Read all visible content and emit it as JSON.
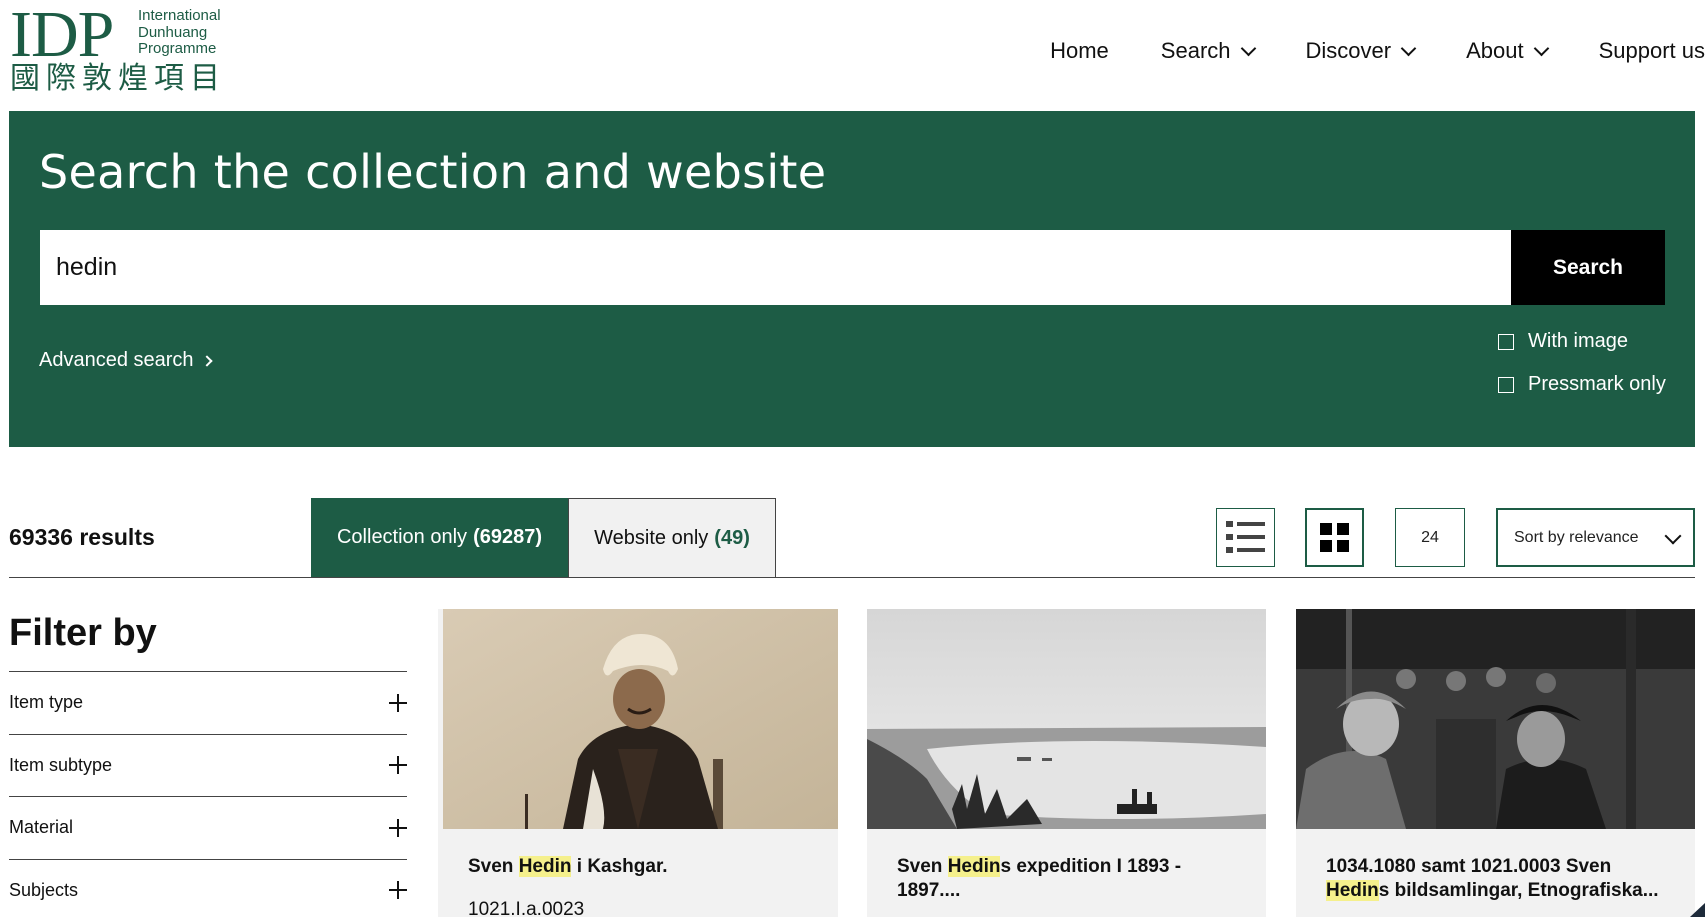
{
  "logo": {
    "text": "IDP",
    "line1": "International",
    "line2": "Dunhuang",
    "line3": "Programme",
    "chinese": "國際敦煌項目"
  },
  "nav": {
    "home": "Home",
    "search": "Search",
    "discover": "Discover",
    "about": "About",
    "support": "Support us"
  },
  "search_panel": {
    "title": "Search the collection and website",
    "query": "hedin",
    "button": "Search",
    "advanced": "Advanced search",
    "with_image": "With image",
    "pressmark_only": "Pressmark only"
  },
  "results": {
    "count": "69336 results",
    "tab_collection": "Collection only",
    "tab_collection_count": "(69287)",
    "tab_website": "Website only",
    "tab_website_count": "(49)",
    "per_page": "24",
    "sort": "Sort by relevance"
  },
  "filters": {
    "title": "Filter by",
    "items": [
      "Item type",
      "Item subtype",
      "Material",
      "Subjects"
    ]
  },
  "cards": [
    {
      "title_pre": "Sven ",
      "title_hl": "Hedin",
      "title_post": " i Kashgar.",
      "subtitle": "1021.I.a.0023"
    },
    {
      "title_pre": "Sven ",
      "title_hl": "Hedin",
      "title_post": "s expedition I 1893 - 1897....",
      "subtitle": ""
    },
    {
      "title_pre": "1034.1080 samt 1021.0003 Sven ",
      "title_hl": "Hedin",
      "title_post": "s bildsamlingar, Etnografiska...",
      "subtitle": ""
    }
  ],
  "colors": {
    "brand_green": "#1d5c45",
    "highlight": "#f5f08c"
  }
}
